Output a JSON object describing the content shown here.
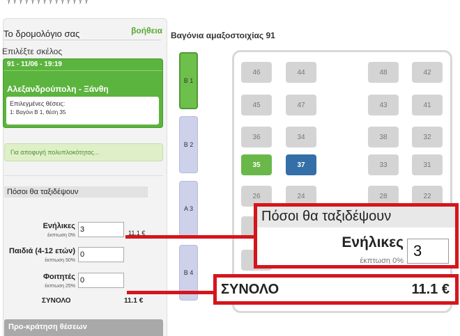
{
  "panel": {
    "help_link": "βοήθεια",
    "route_title": "Το δρομολόγιο σας",
    "leg_label": "Επιλέξτε σκέλος",
    "leg": {
      "date": "91 - 11/06 - 19:19",
      "route": "Αλεξανδρούπολη - Ξάνθη",
      "seats_title": "Επιλεγμένες θέσεις:",
      "seats_item": "1: Βαγόνι Β 1, θέση 35"
    },
    "info_text": "Για αποφυγή πολυπλοκότητας...",
    "pax_header": "Πόσοι θα ταξιδέψουν",
    "passengers": [
      {
        "label": "Ενήλικες",
        "discount": "έκπτωση 0%",
        "value": "3",
        "price": "11.1 €"
      },
      {
        "label": "Παιδιά (4-12 ετών)",
        "discount": "έκπτωση 50%",
        "value": "0",
        "price": ""
      },
      {
        "label": "Φοιτητές",
        "discount": "έκπτωση 25%",
        "value": "0",
        "price": ""
      }
    ],
    "sum_label": "ΣΥΝΟΛΟ",
    "sum_value": "11.1 €",
    "prebook_label": "Προ-κράτηση θέσεων"
  },
  "wagons": {
    "title": "Βαγόνια αμαξοστοιχίας 91",
    "list": [
      "Β 1",
      "Β 2",
      "Α 3",
      "Β 4"
    ],
    "active": "Β 1"
  },
  "seats": {
    "rows": [
      [
        "46",
        "44",
        "48",
        "42"
      ],
      [
        "45",
        "47",
        "43",
        "41"
      ],
      [
        "36",
        "34",
        "38",
        "32"
      ],
      [
        "35",
        "37",
        "33",
        "31"
      ],
      [
        "26",
        "24",
        "28",
        "22"
      ]
    ],
    "selected": "35",
    "current": "37"
  },
  "zoom": {
    "header": "Πόσοι θα ταξιδέψουν",
    "adults_label": "Ενήλικες",
    "adults_discount": "έκπτωση 0%",
    "adults_value": "3",
    "total_label": "ΣΥΝΟΛΟ",
    "total_value": "11.1 €"
  },
  "colors": {
    "accent_green": "#5bb43e",
    "selected_seat": "#6ab84a",
    "current_seat": "#346fa8",
    "callout_red": "#d4161c"
  }
}
